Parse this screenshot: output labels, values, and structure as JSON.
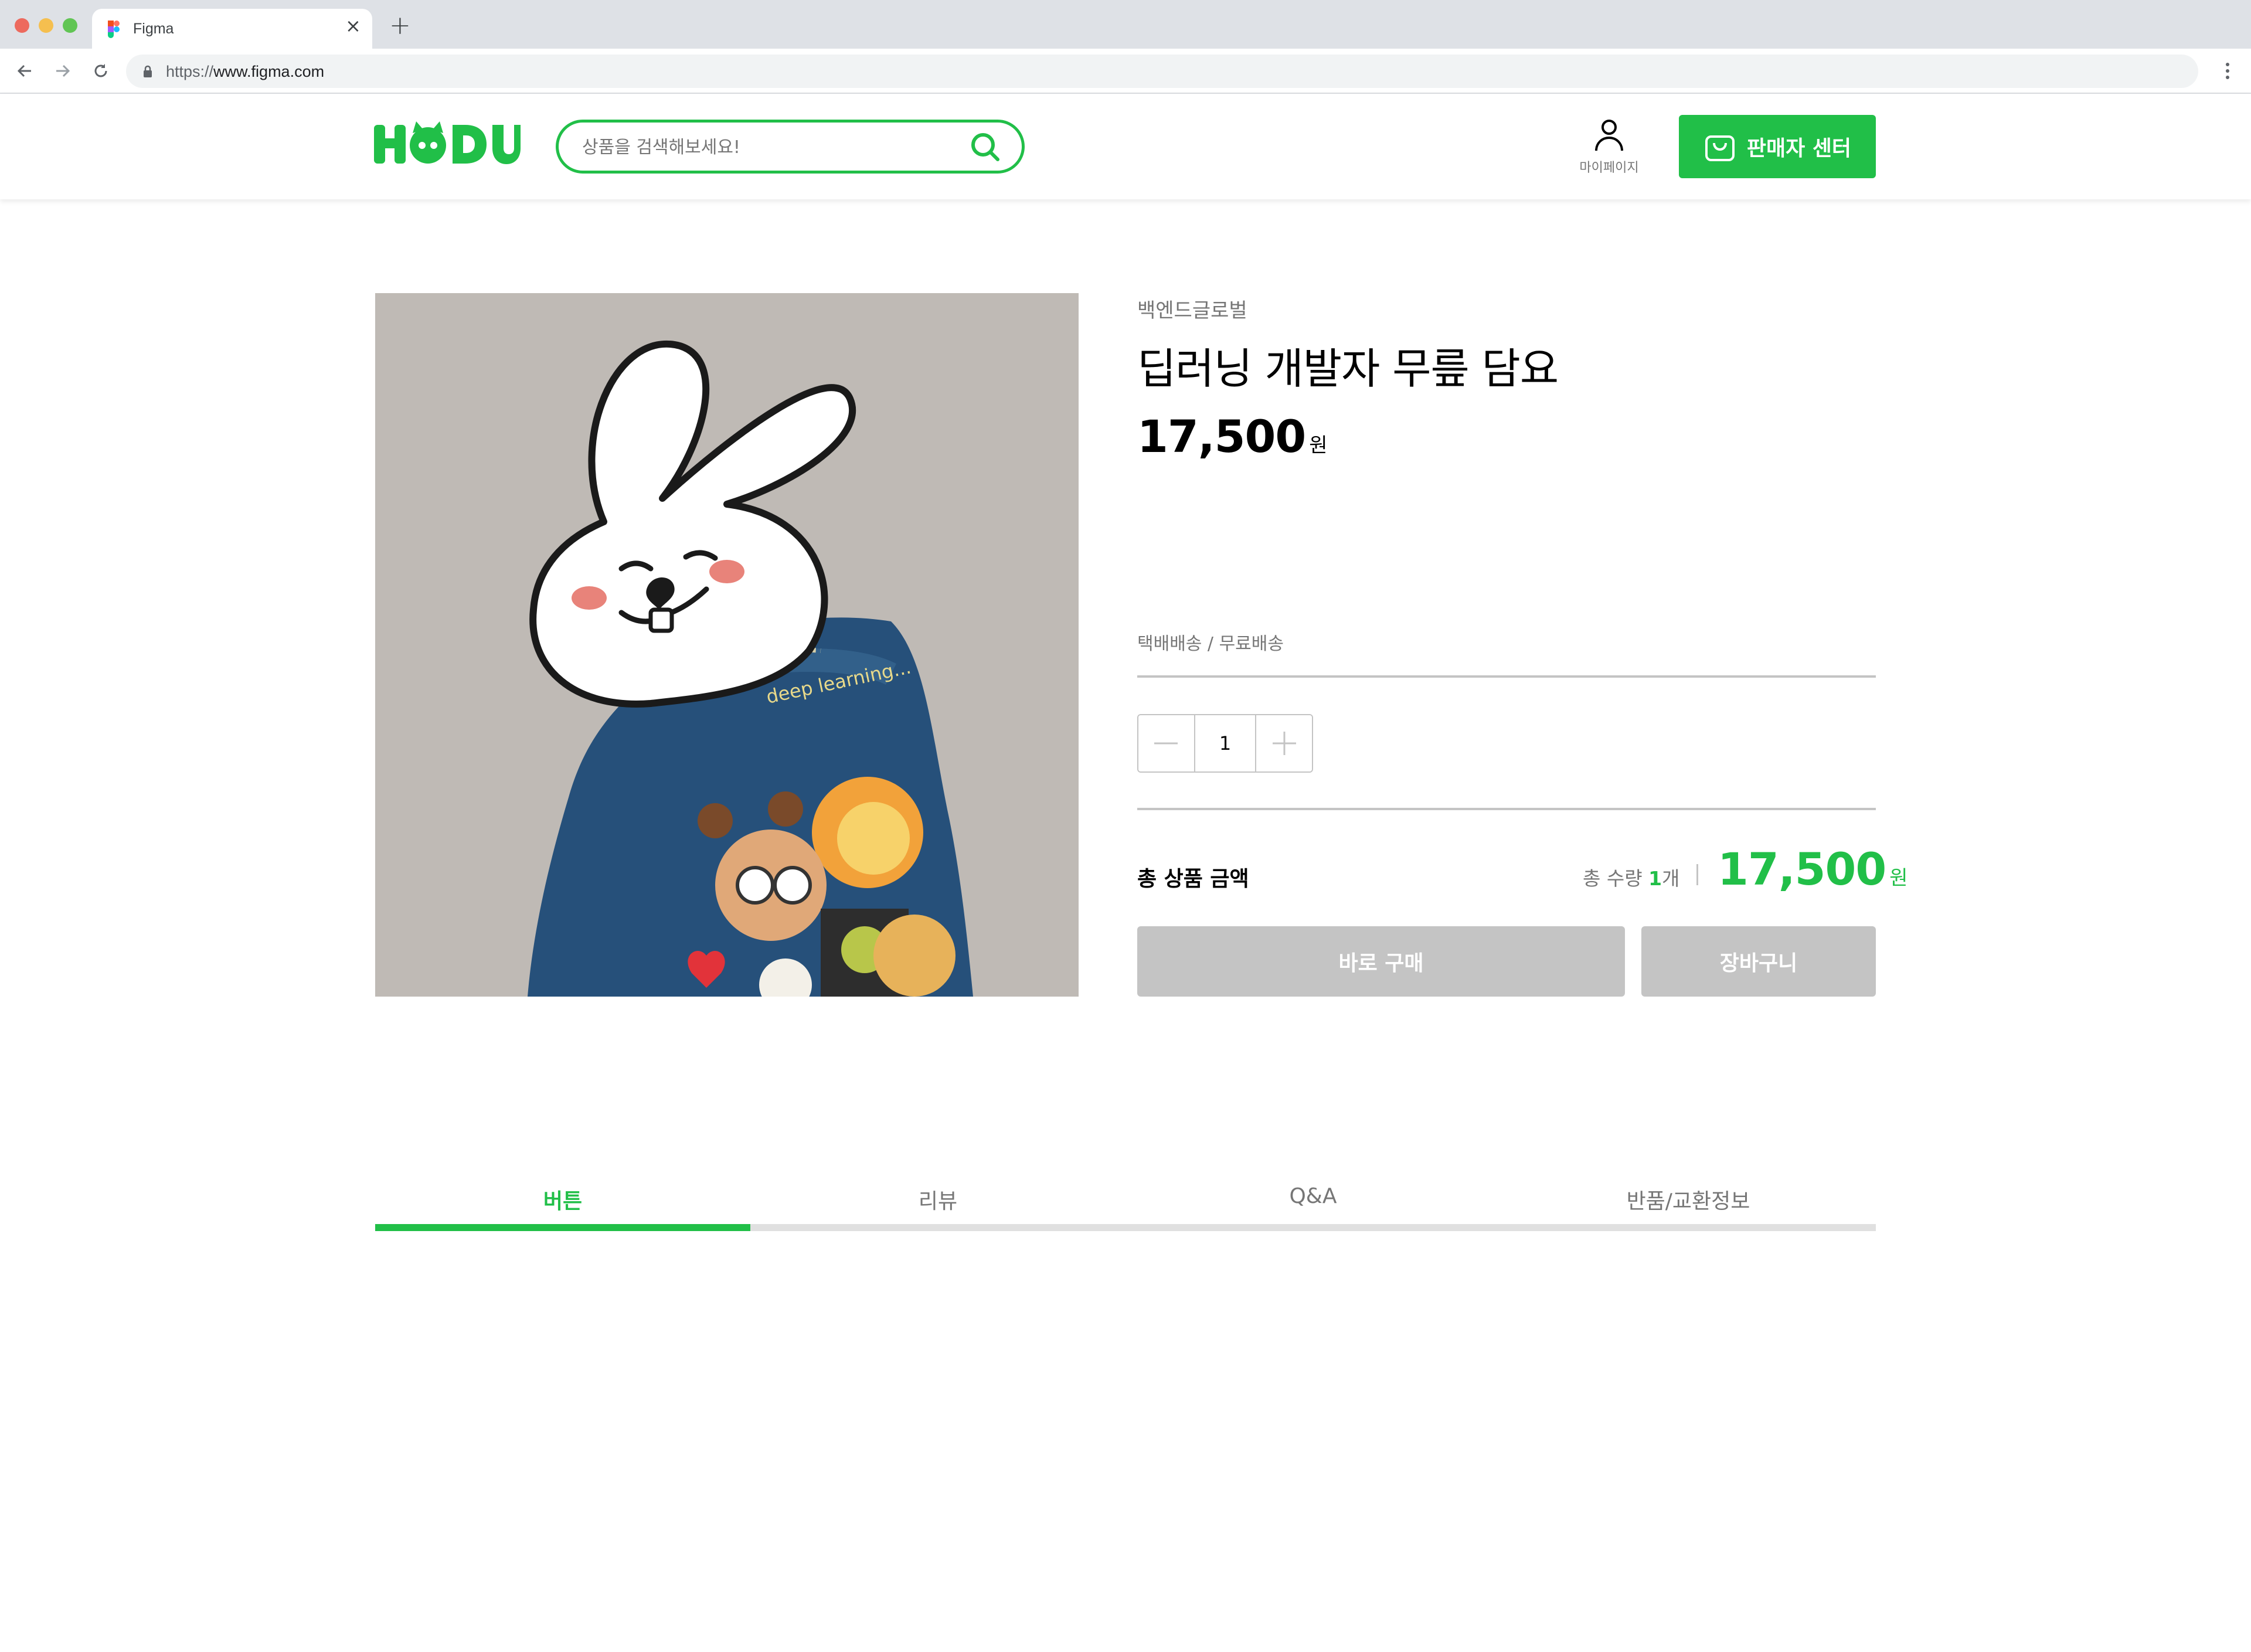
{
  "browser": {
    "tab_title": "Figma",
    "url_scheme": "https://",
    "url_host": "www.figma.com"
  },
  "header": {
    "logo_text": "HODU",
    "search_placeholder": "상품을 검색해보세요!",
    "mypage_label": "마이페이지",
    "seller_center_label": "판매자 센터"
  },
  "product": {
    "seller": "백엔드글로벌",
    "name": "딥러닝 개발자 무릎 담요",
    "price": "17,500",
    "price_unit": "원",
    "delivery": "택배배송 /  무료배송",
    "quantity": "1",
    "total_label": "총 상품 금액",
    "total_qty_prefix": "총 수량 ",
    "total_qty_value": "1",
    "total_qty_suffix": "개",
    "total_price": "17,500",
    "total_price_unit": "원",
    "image_text": "deep learning..."
  },
  "actions": {
    "buy_now": "바로 구매",
    "cart": "장바구니"
  },
  "tabs": [
    {
      "label": "버튼",
      "active": true
    },
    {
      "label": "리뷰",
      "active": false
    },
    {
      "label": "Q&A",
      "active": false
    },
    {
      "label": "반품/교환정보",
      "active": false
    }
  ],
  "colors": {
    "brand_green": "#21bf48",
    "disabled_gray": "#c4c4c4",
    "text_gray": "#767676"
  },
  "icons": [
    "figma-favicon",
    "back-arrow-icon",
    "forward-arrow-icon",
    "reload-icon",
    "lock-icon",
    "kebab-menu-icon",
    "search-icon",
    "user-icon",
    "shopping-bag-icon",
    "minus-icon",
    "plus-icon"
  ]
}
